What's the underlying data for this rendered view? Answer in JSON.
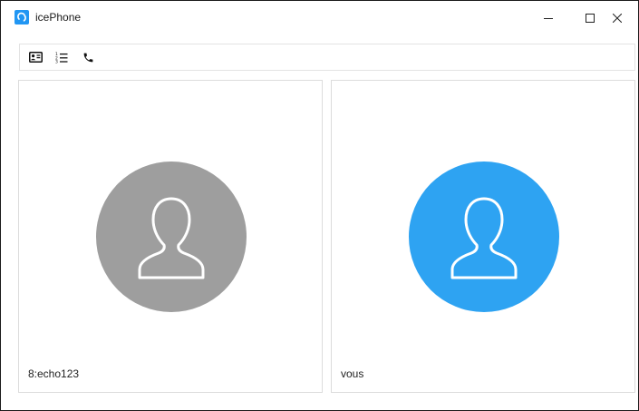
{
  "window": {
    "title": "icePhone",
    "accent_color": "#2196f3"
  },
  "toolbar": {
    "buttons": [
      {
        "icon": "contact-card-icon"
      },
      {
        "icon": "numbered-list-icon"
      },
      {
        "icon": "phone-icon"
      }
    ]
  },
  "participants": [
    {
      "name": "8:echo123",
      "avatar_color": "#9e9e9e",
      "icon": "user-silhouette-icon"
    },
    {
      "name": "vous",
      "avatar_color": "#2ea3f2",
      "icon": "user-silhouette-icon"
    }
  ]
}
